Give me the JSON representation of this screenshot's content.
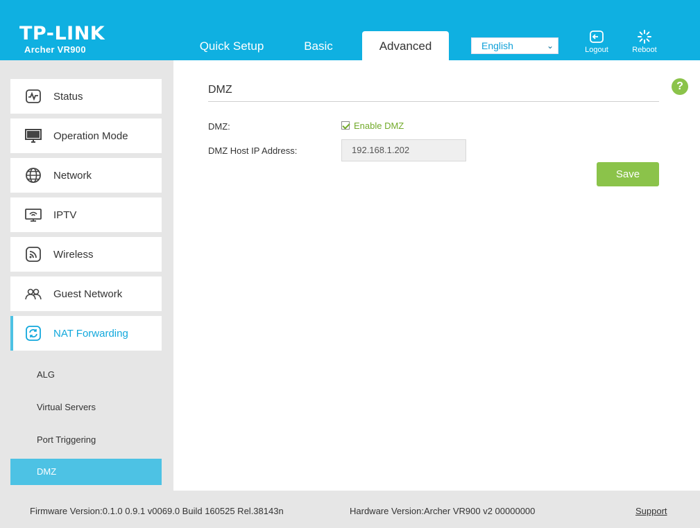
{
  "brand": {
    "logo": "TP-LINK",
    "model": "Archer VR900"
  },
  "tabs": [
    {
      "label": "Quick Setup"
    },
    {
      "label": "Basic"
    },
    {
      "label": "Advanced"
    }
  ],
  "language": {
    "selected": "English"
  },
  "header_buttons": {
    "logout": "Logout",
    "reboot": "Reboot"
  },
  "sidebar": {
    "items": [
      {
        "label": "Status",
        "icon": "status-icon"
      },
      {
        "label": "Operation Mode",
        "icon": "monitor-icon"
      },
      {
        "label": "Network",
        "icon": "globe-icon"
      },
      {
        "label": "IPTV",
        "icon": "tv-icon"
      },
      {
        "label": "Wireless",
        "icon": "wireless-icon"
      },
      {
        "label": "Guest Network",
        "icon": "guests-icon"
      },
      {
        "label": "NAT Forwarding",
        "icon": "nat-forwarding-icon"
      }
    ],
    "subitems": [
      {
        "label": "ALG"
      },
      {
        "label": "Virtual Servers"
      },
      {
        "label": "Port Triggering"
      },
      {
        "label": "DMZ"
      }
    ]
  },
  "main": {
    "title": "DMZ",
    "dmz_label": "DMZ:",
    "enable_label": "Enable DMZ",
    "host_label": "DMZ Host IP Address:",
    "host_ip": "192.168.1.202",
    "save": "Save",
    "help": "?"
  },
  "footer": {
    "firmware": "Firmware Version:0.1.0 0.9.1 v0069.0 Build 160525 Rel.38143n",
    "hardware": "Hardware Version:Archer VR900 v2 00000000",
    "support": "Support"
  },
  "colors": {
    "header": "#0fb0e1",
    "accent": "#4dc2e4",
    "green": "#8bc34a"
  }
}
